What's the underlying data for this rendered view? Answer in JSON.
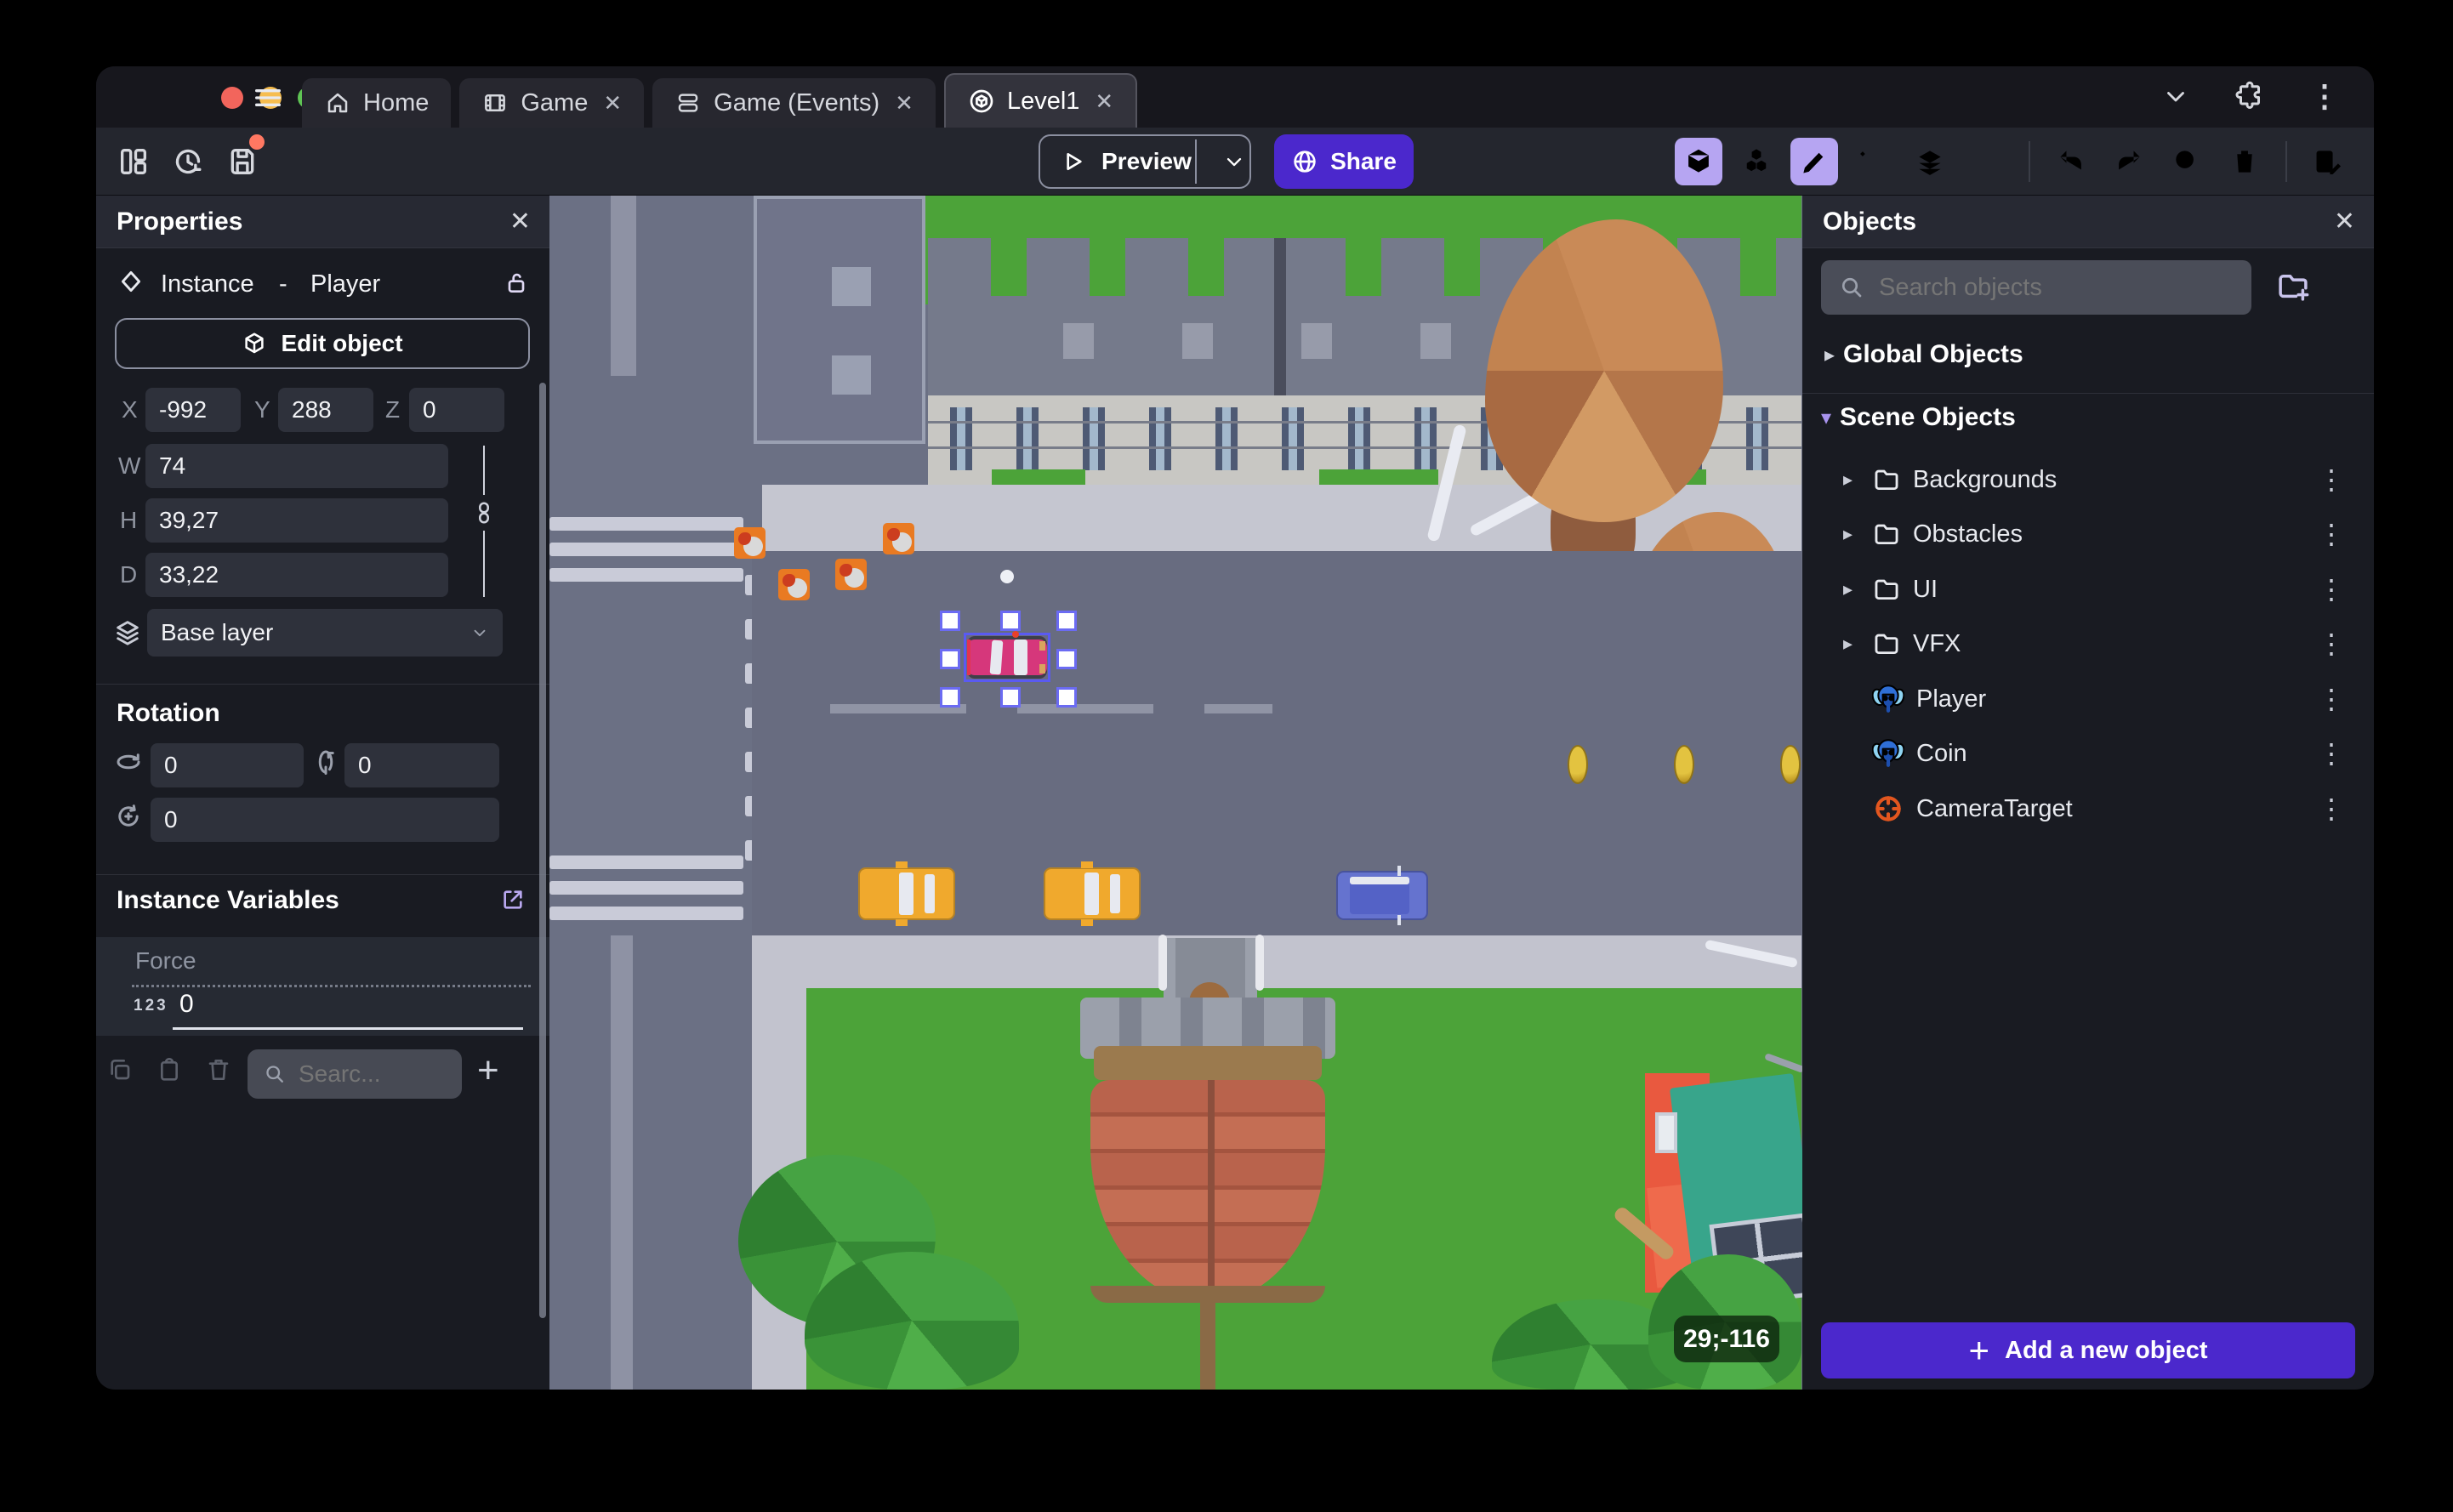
{
  "glyphs": {
    "close": "✕",
    "kebab": "⋮",
    "plus": "+",
    "tri_right": "▸",
    "tri_down": "▾"
  },
  "titlebar": {
    "tabs": [
      {
        "label": "Home"
      },
      {
        "label": "Game"
      },
      {
        "label": "Game (Events)"
      },
      {
        "label": "Level1"
      }
    ]
  },
  "toolbar": {
    "preview": "Preview",
    "share": "Share"
  },
  "properties": {
    "title": "Properties",
    "instance_type": "Instance",
    "separator": "-",
    "object_name": "Player",
    "edit_object": "Edit object",
    "x_label": "X",
    "x": "-992",
    "y_label": "Y",
    "y": "288",
    "z_label": "Z",
    "z": "0",
    "w_label": "W",
    "w": "74",
    "h_label": "H",
    "h": "39,27",
    "d_label": "D",
    "d": "33,22",
    "layer": "Base layer",
    "rotation_title": "Rotation",
    "rot_x": "0",
    "rot_y": "0",
    "rot_z": "0",
    "variables_title": "Instance Variables",
    "variable": {
      "name": "Force",
      "type_badge": "123",
      "value": "0"
    },
    "search_placeholder": "Searc..."
  },
  "objects": {
    "title": "Objects",
    "search_placeholder": "Search objects",
    "global_section": "Global Objects",
    "scene_section": "Scene Objects",
    "tree": [
      {
        "label": "Backgrounds"
      },
      {
        "label": "Obstacles"
      },
      {
        "label": "UI"
      },
      {
        "label": "VFX"
      },
      {
        "label": "Player"
      },
      {
        "label": "Coin"
      },
      {
        "label": "CameraTarget"
      }
    ],
    "add_button": "Add a new object"
  },
  "viewport": {
    "cursor_badge": "29;-116"
  },
  "colors": {
    "accent_purple": "#4b28cc",
    "active_icon_bg": "#b6a5f2",
    "save_dot": "#ff7862",
    "selection_blue": "#6b6bf2"
  }
}
